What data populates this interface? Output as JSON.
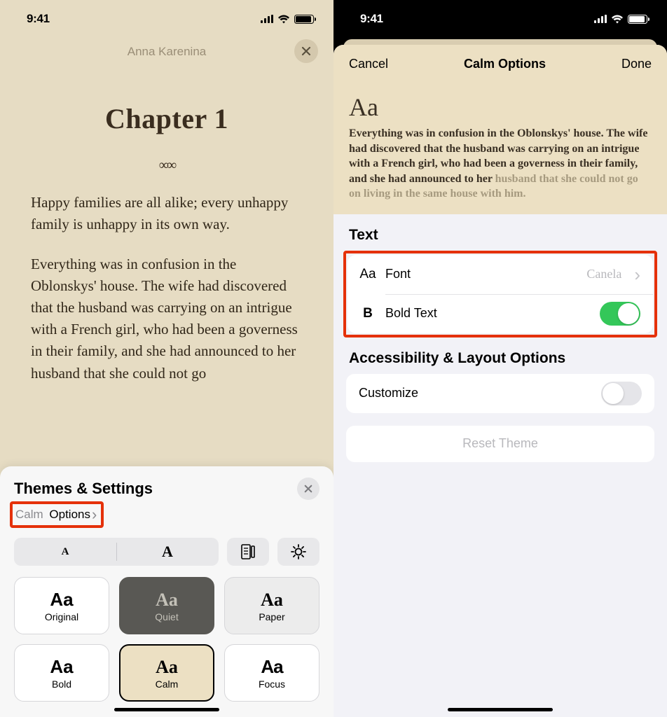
{
  "status": {
    "time": "9:41"
  },
  "left": {
    "book_title": "Anna Karenina",
    "chapter_title": "Chapter 1",
    "para1": "Happy families are all alike; every unhappy family is unhappy in its own way.",
    "para2": "Everything was in confusion in the Oblonskys' house. The wife had dis­covered that the husband was carry­ing on an intrigue with a French girl, who had been a governess in their family, and she had announced to her husband that she could not go",
    "sheet_title": "Themes & Settings",
    "options_theme": "Calm",
    "options_word": "Options",
    "size_small": "A",
    "size_big": "A",
    "themes": {
      "original": "Original",
      "quiet": "Quiet",
      "paper": "Paper",
      "bold": "Bold",
      "calm": "Calm",
      "focus": "Focus"
    },
    "aa": "Aa"
  },
  "right": {
    "cancel": "Cancel",
    "title": "Calm Options",
    "done": "Done",
    "preview_aa": "Aa",
    "preview_main": "Everything was in confusion in the Oblonskys' house. The wife had discovered that the husband was carrying on an intrigue with a French girl, who had been a governess in their family, and she had announced to her ",
    "preview_fade": "husband that she could not go on living in the same house with him.",
    "section_text": "Text",
    "row_font_icon": "Aa",
    "row_font": "Font",
    "row_font_value": "Canela",
    "row_bold_icon": "B",
    "row_bold": "Bold Text",
    "section_access": "Accessibility & Layout Options",
    "row_customize": "Customize",
    "reset": "Reset Theme"
  }
}
